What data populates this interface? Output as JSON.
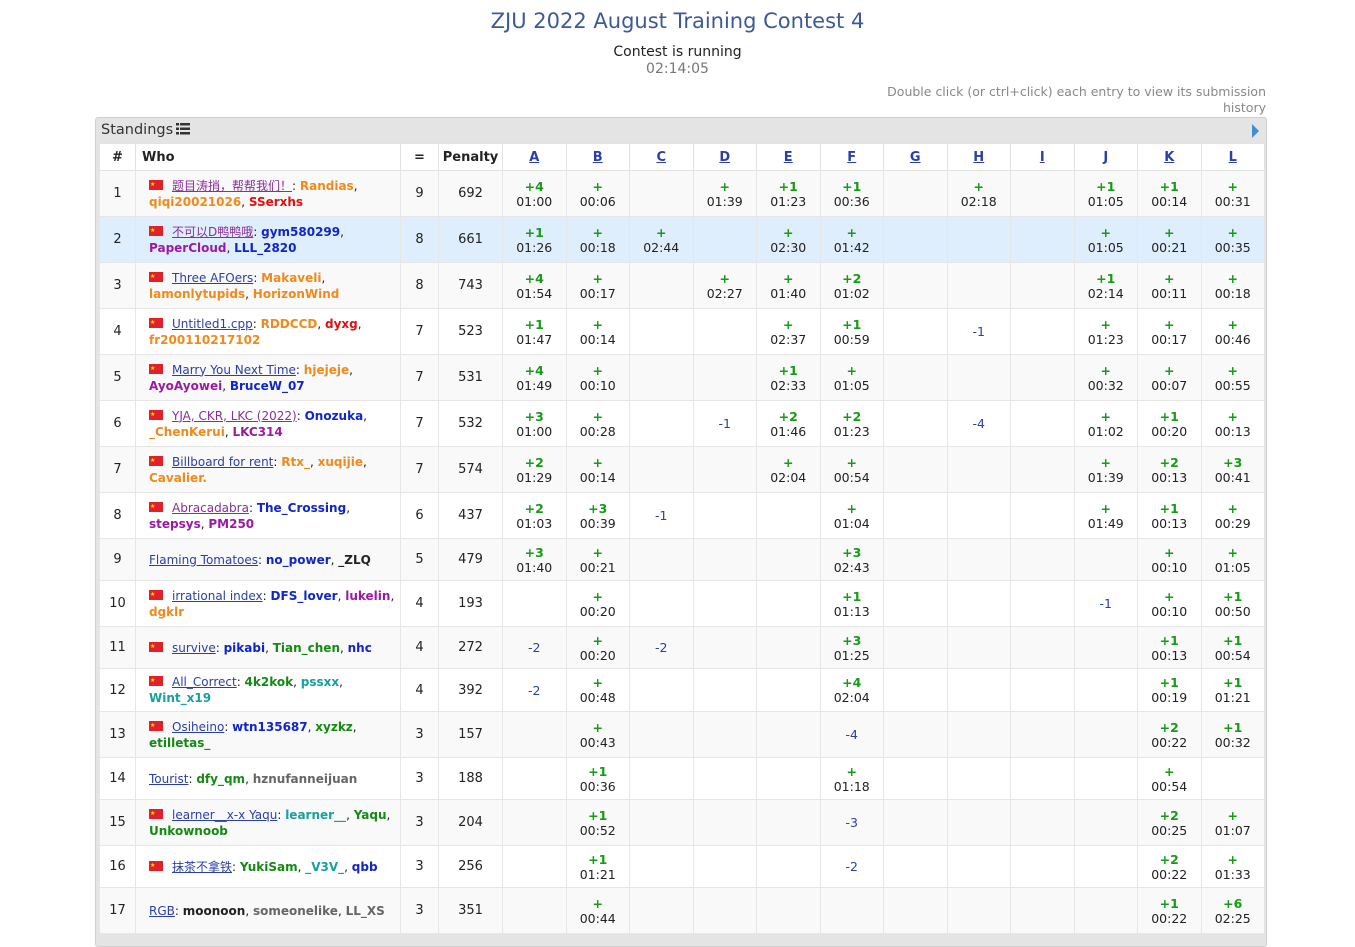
{
  "contest": {
    "title": "ZJU 2022 August Training Contest 4",
    "status": "Contest is running",
    "clock": "02:14:05",
    "hint": "Double click (or ctrl+click) each entry to view its submission history"
  },
  "panel": {
    "title": "Standings"
  },
  "columns": {
    "rank": "#",
    "who": "Who",
    "solved": "=",
    "penalty": "Penalty"
  },
  "problems": [
    "A",
    "B",
    "C",
    "D",
    "E",
    "F",
    "G",
    "H",
    "I",
    "J",
    "K",
    "L"
  ],
  "colors": {
    "title": "#3c5a99",
    "panel_bg": "#e4e4e4",
    "highlight_row": "#dfeefc",
    "accepted": "#159b15",
    "rejected": "#2a3fa8",
    "flag": "#e0212a"
  },
  "rows": [
    {
      "rank": "1",
      "flag": true,
      "team": "题目涛捎，帮帮我们！",
      "team_color": "purple",
      "members": [
        {
          "n": "Randias",
          "c": "orange"
        },
        {
          "n": "qiqi20021026",
          "c": "orange"
        },
        {
          "n": "SSerxhs",
          "c": "red"
        }
      ],
      "solved": "9",
      "penalty": "692",
      "cells": [
        [
          "+4",
          "01:00"
        ],
        [
          "+",
          "00:06"
        ],
        null,
        [
          "+",
          "01:39"
        ],
        [
          "+1",
          "01:23"
        ],
        [
          "+1",
          "00:36"
        ],
        null,
        [
          "+",
          "02:18"
        ],
        null,
        [
          "+1",
          "01:05"
        ],
        [
          "+1",
          "00:14"
        ],
        [
          "+",
          "00:31"
        ]
      ]
    },
    {
      "rank": "2",
      "flag": true,
      "team": "不可以D鸭鸭哦",
      "team_color": "purple",
      "members": [
        {
          "n": "gym580299",
          "c": "blue"
        },
        {
          "n": "PaperCloud",
          "c": "purple"
        },
        {
          "n": "LLL_2820",
          "c": "blue"
        }
      ],
      "solved": "8",
      "penalty": "661",
      "highlight": true,
      "cells": [
        [
          "+1",
          "01:26"
        ],
        [
          "+",
          "00:18"
        ],
        [
          "+",
          "02:44"
        ],
        null,
        [
          "+",
          "02:30"
        ],
        [
          "+",
          "01:42"
        ],
        null,
        null,
        null,
        [
          "+",
          "01:05"
        ],
        [
          "+",
          "00:21"
        ],
        [
          "+",
          "00:35"
        ]
      ]
    },
    {
      "rank": "3",
      "flag": true,
      "team": "Three AFOers",
      "team_color": "blue",
      "members": [
        {
          "n": "Makaveli",
          "c": "orange"
        },
        {
          "n": "lamonlytupids",
          "c": "orange"
        },
        {
          "n": "HorizonWind",
          "c": "orange"
        }
      ],
      "solved": "8",
      "penalty": "743",
      "cells": [
        [
          "+4",
          "01:54"
        ],
        [
          "+",
          "00:17"
        ],
        null,
        [
          "+",
          "02:27"
        ],
        [
          "+",
          "01:40"
        ],
        [
          "+2",
          "01:02"
        ],
        null,
        null,
        null,
        [
          "+1",
          "02:14"
        ],
        [
          "+",
          "00:11"
        ],
        [
          "+",
          "00:18"
        ]
      ]
    },
    {
      "rank": "4",
      "flag": true,
      "team": "Untitled1.cpp",
      "team_color": "blue",
      "members": [
        {
          "n": "RDDCCD",
          "c": "orange"
        },
        {
          "n": "dyxg",
          "c": "red"
        },
        {
          "n": "fr200110217102",
          "c": "orange"
        }
      ],
      "solved": "7",
      "penalty": "523",
      "cells": [
        [
          "+1",
          "01:47"
        ],
        [
          "+",
          "00:14"
        ],
        null,
        null,
        [
          "+",
          "02:37"
        ],
        [
          "+1",
          "00:59"
        ],
        null,
        [
          "-1"
        ],
        null,
        [
          "+",
          "01:23"
        ],
        [
          "+",
          "00:17"
        ],
        [
          "+",
          "00:46"
        ]
      ]
    },
    {
      "rank": "5",
      "flag": true,
      "team": "Marry You Next Time",
      "team_color": "blue",
      "members": [
        {
          "n": "hjejeje",
          "c": "orange"
        },
        {
          "n": "AyoAyowei",
          "c": "purple"
        },
        {
          "n": "BruceW_07",
          "c": "blue"
        }
      ],
      "solved": "7",
      "penalty": "531",
      "cells": [
        [
          "+4",
          "01:49"
        ],
        [
          "+",
          "00:10"
        ],
        null,
        null,
        [
          "+1",
          "02:33"
        ],
        [
          "+",
          "01:05"
        ],
        null,
        null,
        null,
        [
          "+",
          "00:32"
        ],
        [
          "+",
          "00:07"
        ],
        [
          "+",
          "00:55"
        ]
      ]
    },
    {
      "rank": "6",
      "flag": true,
      "team": "YJA, CKR, LKC (2022)",
      "team_color": "purple",
      "members": [
        {
          "n": "Onozuka",
          "c": "blue"
        },
        {
          "n": "_ChenKerui",
          "c": "orange"
        },
        {
          "n": "LKC314",
          "c": "purple"
        }
      ],
      "solved": "7",
      "penalty": "532",
      "cells": [
        [
          "+3",
          "01:00"
        ],
        [
          "+",
          "00:28"
        ],
        null,
        [
          "-1"
        ],
        [
          "+2",
          "01:46"
        ],
        [
          "+2",
          "01:23"
        ],
        null,
        [
          "-4"
        ],
        null,
        [
          "+",
          "01:02"
        ],
        [
          "+1",
          "00:20"
        ],
        [
          "+",
          "00:13"
        ]
      ]
    },
    {
      "rank": "7",
      "flag": true,
      "team": "Billboard for rent",
      "team_color": "blue",
      "members": [
        {
          "n": "Rtx_",
          "c": "orange"
        },
        {
          "n": "xuqijie",
          "c": "orange"
        },
        {
          "n": "Cavalier.",
          "c": "orange"
        }
      ],
      "solved": "7",
      "penalty": "574",
      "cells": [
        [
          "+2",
          "01:29"
        ],
        [
          "+",
          "00:14"
        ],
        null,
        null,
        [
          "+",
          "02:04"
        ],
        [
          "+",
          "00:54"
        ],
        null,
        null,
        null,
        [
          "+",
          "01:39"
        ],
        [
          "+2",
          "00:13"
        ],
        [
          "+3",
          "00:41"
        ]
      ]
    },
    {
      "rank": "8",
      "flag": true,
      "team": "Abracadabra",
      "team_color": "purple",
      "members": [
        {
          "n": "The_Crossing",
          "c": "blue"
        },
        {
          "n": "stepsys",
          "c": "purple"
        },
        {
          "n": "PM250",
          "c": "purple"
        }
      ],
      "solved": "6",
      "penalty": "437",
      "cells": [
        [
          "+2",
          "01:03"
        ],
        [
          "+3",
          "00:39"
        ],
        [
          "-1"
        ],
        null,
        null,
        [
          "+",
          "01:04"
        ],
        null,
        null,
        null,
        [
          "+",
          "01:49"
        ],
        [
          "+1",
          "00:13"
        ],
        [
          "+",
          "00:29"
        ]
      ]
    },
    {
      "rank": "9",
      "flag": false,
      "team": "Flaming Tomatoes",
      "team_color": "blue",
      "members": [
        {
          "n": "no_power",
          "c": "blue"
        },
        {
          "n": "_ZLQ",
          "c": "black"
        }
      ],
      "solved": "5",
      "penalty": "479",
      "cells": [
        [
          "+3",
          "01:40"
        ],
        [
          "+",
          "00:21"
        ],
        null,
        null,
        null,
        [
          "+3",
          "02:43"
        ],
        null,
        null,
        null,
        null,
        [
          "+",
          "00:10"
        ],
        [
          "+",
          "01:05"
        ]
      ]
    },
    {
      "rank": "10",
      "flag": true,
      "team": "irrational index",
      "team_color": "blue",
      "members": [
        {
          "n": "DFS_lover",
          "c": "blue"
        },
        {
          "n": "lukelin",
          "c": "purple"
        },
        {
          "n": "dgklr",
          "c": "orange"
        }
      ],
      "solved": "4",
      "penalty": "193",
      "cells": [
        null,
        [
          "+",
          "00:20"
        ],
        null,
        null,
        null,
        [
          "+1",
          "01:13"
        ],
        null,
        null,
        null,
        [
          "-1"
        ],
        [
          "+",
          "00:10"
        ],
        [
          "+1",
          "00:50"
        ]
      ]
    },
    {
      "rank": "11",
      "flag": true,
      "team": "survive",
      "team_color": "blue",
      "members": [
        {
          "n": "pikabi",
          "c": "blue"
        },
        {
          "n": "Tian_chen",
          "c": "green"
        },
        {
          "n": "nhc",
          "c": "blue"
        }
      ],
      "solved": "4",
      "penalty": "272",
      "cells": [
        [
          "-2"
        ],
        [
          "+",
          "00:20"
        ],
        [
          "-2"
        ],
        null,
        null,
        [
          "+3",
          "01:25"
        ],
        null,
        null,
        null,
        null,
        [
          "+1",
          "00:13"
        ],
        [
          "+1",
          "00:54"
        ]
      ]
    },
    {
      "rank": "12",
      "flag": true,
      "team": "All_Correct",
      "team_color": "blue",
      "members": [
        {
          "n": "4k2kok",
          "c": "green"
        },
        {
          "n": "pssxx",
          "c": "cyan"
        },
        {
          "n": "Wint_x19",
          "c": "cyan"
        }
      ],
      "solved": "4",
      "penalty": "392",
      "cells": [
        [
          "-2"
        ],
        [
          "+",
          "00:48"
        ],
        null,
        null,
        null,
        [
          "+4",
          "02:04"
        ],
        null,
        null,
        null,
        null,
        [
          "+1",
          "00:19"
        ],
        [
          "+1",
          "01:21"
        ]
      ]
    },
    {
      "rank": "13",
      "flag": true,
      "team": "Osiheino",
      "team_color": "blue",
      "members": [
        {
          "n": "wtn135687",
          "c": "blue"
        },
        {
          "n": "xyzkz",
          "c": "green"
        },
        {
          "n": "etilletas_",
          "c": "green"
        }
      ],
      "solved": "3",
      "penalty": "157",
      "cells": [
        null,
        [
          "+",
          "00:43"
        ],
        null,
        null,
        null,
        [
          "-4"
        ],
        null,
        null,
        null,
        null,
        [
          "+2",
          "00:22"
        ],
        [
          "+1",
          "00:32"
        ]
      ]
    },
    {
      "rank": "14",
      "flag": false,
      "team": "Tourist",
      "team_color": "blue",
      "members": [
        {
          "n": "dfy_qm",
          "c": "green"
        },
        {
          "n": "hznufanneijuan",
          "c": "gray"
        }
      ],
      "solved": "3",
      "penalty": "188",
      "cells": [
        null,
        [
          "+1",
          "00:36"
        ],
        null,
        null,
        null,
        [
          "+",
          "01:18"
        ],
        null,
        null,
        null,
        null,
        [
          "+",
          "00:54"
        ],
        null
      ]
    },
    {
      "rank": "15",
      "flag": true,
      "team": "learner__x-x Yaqu",
      "team_color": "blue",
      "members": [
        {
          "n": "learner__",
          "c": "cyan"
        },
        {
          "n": "Yaqu",
          "c": "green"
        },
        {
          "n": "Unkownoob",
          "c": "green"
        }
      ],
      "solved": "3",
      "penalty": "204",
      "cells": [
        null,
        [
          "+1",
          "00:52"
        ],
        null,
        null,
        null,
        [
          "-3"
        ],
        null,
        null,
        null,
        null,
        [
          "+2",
          "00:25"
        ],
        [
          "+",
          "01:07"
        ]
      ]
    },
    {
      "rank": "16",
      "flag": true,
      "team": "抹茶不拿铁",
      "team_color": "blue",
      "members": [
        {
          "n": "YukiSam",
          "c": "green"
        },
        {
          "n": "_V3V_",
          "c": "cyan"
        },
        {
          "n": "qbb",
          "c": "blue"
        }
      ],
      "solved": "3",
      "penalty": "256",
      "cells": [
        null,
        [
          "+1",
          "01:21"
        ],
        null,
        null,
        null,
        [
          "-2"
        ],
        null,
        null,
        null,
        null,
        [
          "+2",
          "00:22"
        ],
        [
          "+",
          "01:33"
        ]
      ]
    },
    {
      "rank": "17",
      "flag": false,
      "team": "RGB",
      "team_color": "blue",
      "members": [
        {
          "n": "moonoon",
          "c": "black"
        },
        {
          "n": "someonelike",
          "c": "gray"
        },
        {
          "n": "LL_XS",
          "c": "gray"
        }
      ],
      "solved": "3",
      "penalty": "351",
      "cells": [
        null,
        [
          "+",
          "00:44"
        ],
        null,
        null,
        null,
        null,
        null,
        null,
        null,
        null,
        [
          "+1",
          "00:22"
        ],
        [
          "+6",
          "02:25"
        ]
      ]
    }
  ]
}
